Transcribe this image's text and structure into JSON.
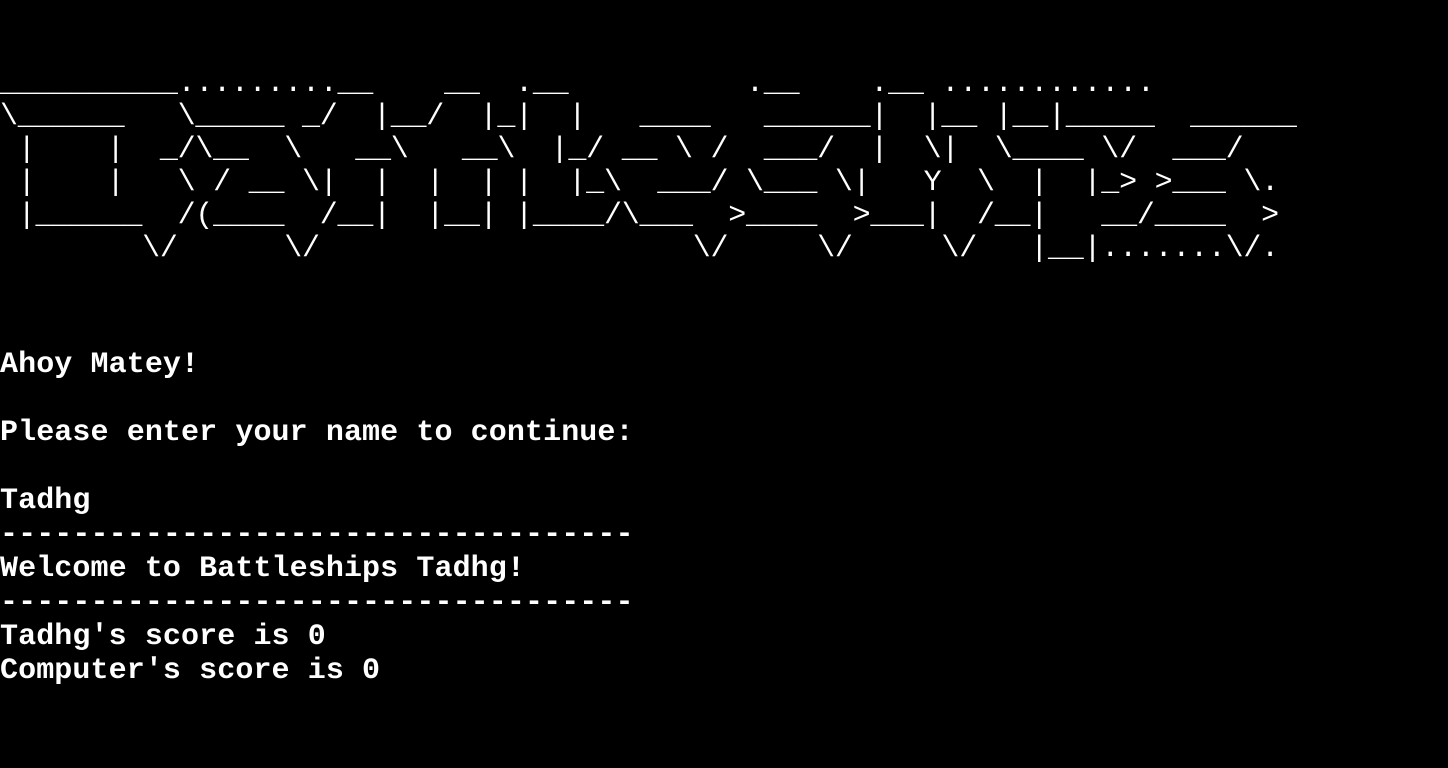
{
  "banner": {
    "lines": [
      "__________.........__    __  .__          .__    .__ ............",
      "\\______   \\_____ _/  |__/  |_|  |   ____   ______|  |__ |__|_____  ______",
      " |    |  _/\\__  \\   __\\   __\\  |_/ __ \\ /  ___/  |  \\|  \\____ \\/  ___/",
      " |    |   \\ / __ \\|  |  |  | |  |_\\  ___/ \\___ \\|   Y  \\  |  |_> >___ \\.",
      " |______  /(____  /__|  |__| |____/\\___  >____  >___|  /__|   __/____  >",
      "        \\/      \\/                     \\/     \\/     \\/   |__|.......\\/."
    ]
  },
  "console": {
    "greeting": "Ahoy Matey!",
    "name_prompt": "Please enter your name to continue:",
    "name_input": "Tadhg",
    "divider": "-----------------------------------",
    "welcome": "Welcome to Battleships Tadhg!",
    "player_score": "Tadhg's score is 0",
    "computer_score": "Computer's score is 0"
  }
}
